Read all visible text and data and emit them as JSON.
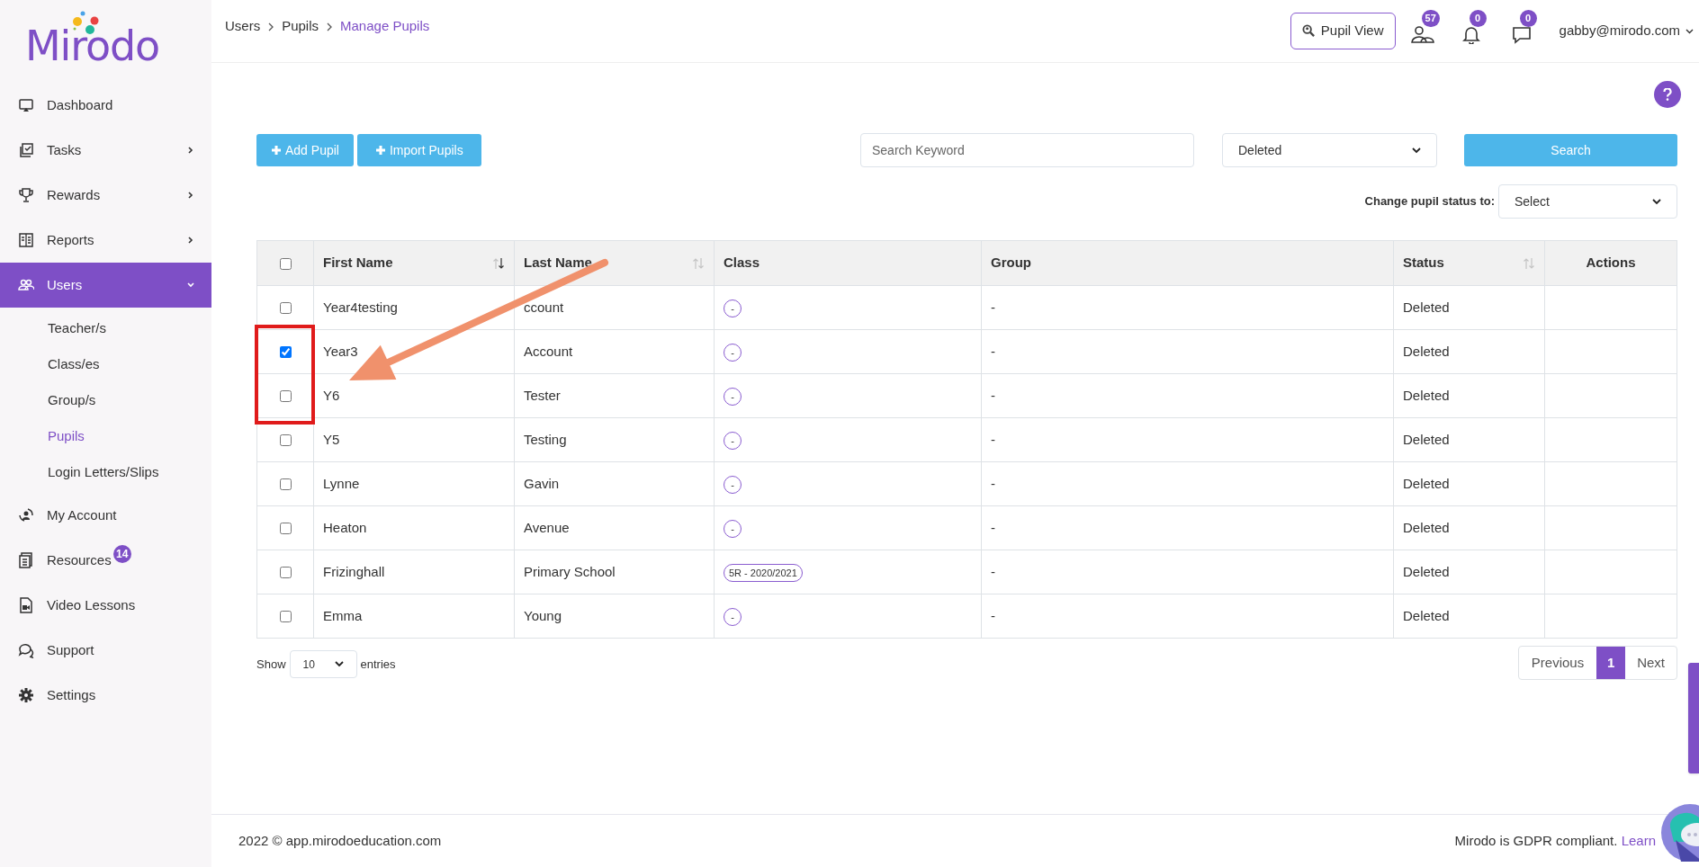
{
  "logo": {
    "text": "Mirodo"
  },
  "sidebar": {
    "items": [
      {
        "label": "Dashboard",
        "selected": false
      },
      {
        "label": "Tasks",
        "selected": false,
        "expanded": false
      },
      {
        "label": "Rewards",
        "selected": false,
        "expanded": false
      },
      {
        "label": "Reports",
        "selected": false,
        "expanded": false
      },
      {
        "label": "Users",
        "selected": true,
        "expanded": true,
        "children": [
          {
            "label": "Teacher/s",
            "selected": false
          },
          {
            "label": "Class/es",
            "selected": false
          },
          {
            "label": "Group/s",
            "selected": false
          },
          {
            "label": "Pupils",
            "selected": true
          },
          {
            "label": "Login Letters/Slips",
            "selected": false
          }
        ]
      },
      {
        "label": "My Account",
        "selected": false
      },
      {
        "label": "Resources",
        "selected": false,
        "badge": "14"
      },
      {
        "label": "Video Lessons",
        "selected": false
      },
      {
        "label": "Support",
        "selected": false
      },
      {
        "label": "Settings",
        "selected": false
      }
    ]
  },
  "breadcrumbs": [
    {
      "label": "Users",
      "current": false
    },
    {
      "label": "Pupils",
      "current": false
    },
    {
      "label": "Manage Pupils",
      "current": true
    }
  ],
  "header": {
    "pupil_view": "Pupil View",
    "badges": [
      "57",
      "0",
      "0"
    ],
    "user": "gabby@mirodo.com"
  },
  "toolbar": {
    "add": "Add Pupil",
    "import": "Import Pupils",
    "search_placeholder": "Search Keyword",
    "status_filter": "Deleted",
    "search": "Search",
    "change_label": "Change pupil status to:",
    "change_select": "Select"
  },
  "table": {
    "select_all": false,
    "columns": [
      {
        "label": "First Name",
        "sortable": true,
        "sorted": true
      },
      {
        "label": "Last Name",
        "sortable": true,
        "sorted": false
      },
      {
        "label": "Class",
        "sortable": false
      },
      {
        "label": "Group",
        "sortable": false
      },
      {
        "label": "Status",
        "sortable": true,
        "sorted": false
      },
      {
        "label": "Actions",
        "sortable": false
      }
    ],
    "rows": [
      {
        "checked": false,
        "first_name": "Year4testing",
        "last_name": "ccount",
        "class": "-",
        "group": "-",
        "status": "Deleted"
      },
      {
        "checked": true,
        "first_name": "Year3",
        "last_name": "Account",
        "class": "-",
        "group": "-",
        "status": "Deleted"
      },
      {
        "checked": false,
        "first_name": "Y6",
        "last_name": "Tester",
        "class": "-",
        "group": "-",
        "status": "Deleted"
      },
      {
        "checked": false,
        "first_name": "Y5",
        "last_name": "Testing",
        "class": "-",
        "group": "-",
        "status": "Deleted"
      },
      {
        "checked": false,
        "first_name": "Lynne",
        "last_name": "Gavin",
        "class": "-",
        "group": "-",
        "status": "Deleted"
      },
      {
        "checked": false,
        "first_name": "Heaton",
        "last_name": "Avenue",
        "class": "-",
        "group": "-",
        "status": "Deleted"
      },
      {
        "checked": false,
        "first_name": "Frizinghall",
        "last_name": "Primary School",
        "class": "5R - 2020/2021",
        "group": "-",
        "status": "Deleted"
      },
      {
        "checked": false,
        "first_name": "Emma",
        "last_name": "Young",
        "class": "-",
        "group": "-",
        "status": "Deleted"
      }
    ]
  },
  "length": {
    "show": "Show",
    "value": "10",
    "entries": "entries"
  },
  "pagination": {
    "previous": "Previous",
    "pages": [
      {
        "label": "1",
        "selected": true
      }
    ],
    "next": "Next"
  },
  "footer": {
    "copyright": "2022 © app.mirodoeducation.com",
    "gdpr": "Mirodo is GDPR compliant.",
    "link": "Learn"
  }
}
